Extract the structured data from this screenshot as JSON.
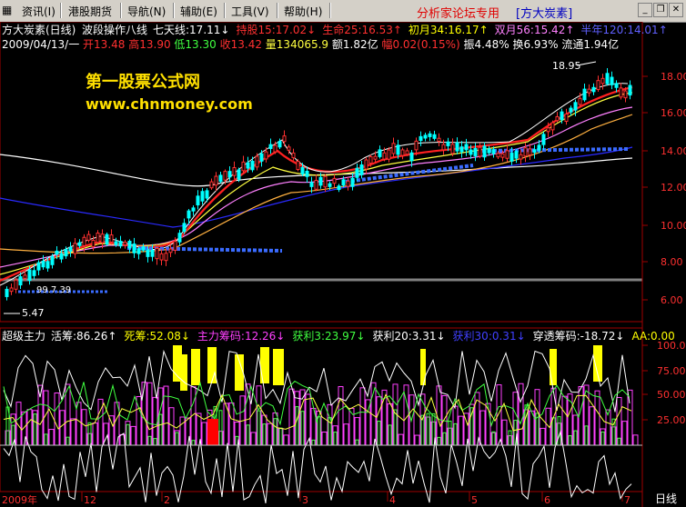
{
  "menu": {
    "items": [
      "资讯(I)",
      "港股期货",
      "导航(N)",
      "辅助(E)",
      "工具(V)",
      "帮助(H)"
    ],
    "forum_label": "分析家论坛专用",
    "stock_label": "[方大炭素]"
  },
  "header1": {
    "title": "方大炭素(日线)",
    "indicator": "波段操作八线",
    "items": [
      {
        "text": "七天线:17.11",
        "arrow": "↓",
        "color": "#ffffff"
      },
      {
        "text": "持股15:17.02",
        "arrow": "↓",
        "color": "#ff3030"
      },
      {
        "text": "生命25:16.53",
        "arrow": "↑",
        "color": "#ff3030"
      },
      {
        "text": "初月34:16.17",
        "arrow": "↑",
        "color": "#ffff00"
      },
      {
        "text": "双月56:15.42",
        "arrow": "↑",
        "color": "#ff80ff"
      },
      {
        "text": "半年120:14.01",
        "arrow": "↑",
        "color": "#6060ff"
      }
    ]
  },
  "header2": {
    "date": "2009/04/13/一",
    "open": "开13.48",
    "high": "高13.90",
    "low": "低13.30",
    "close": "收13.42",
    "volume": "量134065.9",
    "amount": "额1.82亿",
    "change": "幅0.02(0.15%)",
    "amplitude": "振4.48%",
    "turnover": "换6.93%",
    "float_shares": "流通1.94亿"
  },
  "watermark": {
    "line1": "第一股票公式网",
    "line2": "www.chnmoney.com"
  },
  "annotations": {
    "high": "18.95",
    "low": "5.47",
    "mid": "99.7.39"
  },
  "price_axis": [
    "18.00",
    "16.00",
    "14.00",
    "12.00",
    "10.00",
    "8.00",
    "6.00"
  ],
  "indicator_header": {
    "name": "超级主力",
    "items": [
      {
        "text": "活筹:86.26",
        "arrow": "↑",
        "color": "#ffffff"
      },
      {
        "text": "死筹:52.08",
        "arrow": "↓",
        "color": "#ffff00"
      },
      {
        "text": "主力筹码:12.26",
        "arrow": "↓",
        "color": "#ff40ff"
      },
      {
        "text": "获利3:23.97",
        "arrow": "↓",
        "color": "#40ff40"
      },
      {
        "text": "获利20:3.31",
        "arrow": "↓",
        "color": "#ffffff"
      },
      {
        "text": "获利30:0.31",
        "arrow": "↓",
        "color": "#4040ff"
      },
      {
        "text": "穿透筹码:-18.72",
        "arrow": "↓",
        "color": "#ffffff"
      },
      {
        "text": "AA:0.00",
        "arrow": "",
        "color": "#ffff00"
      }
    ]
  },
  "indicator_axis": [
    "100.0",
    "75.00",
    "50.00",
    "25.00"
  ],
  "x_axis": {
    "year": "2009年",
    "months": [
      "12",
      "2",
      "3",
      "4",
      "5",
      "6",
      "7"
    ],
    "period_label": "日线"
  },
  "colors": {
    "up": "#ff3030",
    "down": "#00ffff",
    "ma7": "#ffffff",
    "ma15": "#ff2020",
    "ma25": "#ff6060",
    "ma34": "#ffff40",
    "ma56": "#ff80ff",
    "ma120": "#4040ff"
  }
}
